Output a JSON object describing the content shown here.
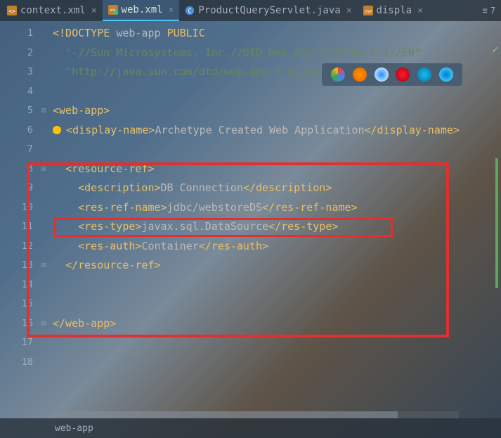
{
  "tabs": [
    {
      "label": "context.xml",
      "icon": "xml",
      "active": false
    },
    {
      "label": "web.xml",
      "icon": "xml-cfg",
      "active": true
    },
    {
      "label": "ProductQueryServlet.java",
      "icon": "java",
      "active": false
    },
    {
      "label": "displa",
      "icon": "jsp",
      "active": false
    }
  ],
  "tab_counter": "7",
  "code_lines": [
    {
      "n": 1,
      "fold": "",
      "tokens": [
        {
          "t": "<!DOCTYPE ",
          "c": "tagname"
        },
        {
          "t": "web-app ",
          "c": "txt"
        },
        {
          "t": "PUBLIC",
          "c": "tagname"
        }
      ]
    },
    {
      "n": 2,
      "fold": "",
      "tokens": [
        {
          "t": "  ",
          "c": ""
        },
        {
          "t": "\"-//Sun Microsystems, Inc.//DTD Web Application 2.3//EN\"",
          "c": "str"
        }
      ]
    },
    {
      "n": 3,
      "fold": "",
      "tokens": [
        {
          "t": "  ",
          "c": ""
        },
        {
          "t": "\"http://java.sun.com/dtd/web-app_2_3.dtd\"",
          "c": "str"
        },
        {
          "t": " >",
          "c": "tagname"
        }
      ]
    },
    {
      "n": 4,
      "fold": "",
      "tokens": []
    },
    {
      "n": 5,
      "fold": "⊟",
      "tokens": [
        {
          "t": "<web-app>",
          "c": "tagname"
        }
      ]
    },
    {
      "n": 6,
      "fold": "",
      "bulb": true,
      "tokens": [
        {
          "t": " ",
          "c": ""
        },
        {
          "t": "<display-name>",
          "c": "tagname"
        },
        {
          "t": "Archetype Created Web Application",
          "c": "txt"
        },
        {
          "t": "</display-name>",
          "c": "tagname"
        }
      ]
    },
    {
      "n": 7,
      "fold": "",
      "tokens": []
    },
    {
      "n": 8,
      "fold": "⊟",
      "tokens": [
        {
          "t": "  ",
          "c": ""
        },
        {
          "t": "<resource-ref>",
          "c": "tagname"
        }
      ]
    },
    {
      "n": 9,
      "fold": "",
      "tokens": [
        {
          "t": "    ",
          "c": ""
        },
        {
          "t": "<description>",
          "c": "tagname"
        },
        {
          "t": "DB Connection",
          "c": "txt"
        },
        {
          "t": "</description>",
          "c": "tagname"
        }
      ]
    },
    {
      "n": 10,
      "fold": "",
      "tokens": [
        {
          "t": "    ",
          "c": ""
        },
        {
          "t": "<res-ref-name>",
          "c": "tagname"
        },
        {
          "t": "jdbc/",
          "c": "txt"
        },
        {
          "t": "webstoreDS",
          "c": "txt",
          "underline": true
        },
        {
          "t": "</res-ref-name>",
          "c": "tagname"
        }
      ]
    },
    {
      "n": 11,
      "fold": "",
      "tokens": [
        {
          "t": "    ",
          "c": ""
        },
        {
          "t": "<res-type>",
          "c": "tagname"
        },
        {
          "t": "javax.sql.DataSource",
          "c": "txt"
        },
        {
          "t": "</res-type>",
          "c": "tagname"
        }
      ]
    },
    {
      "n": 12,
      "fold": "",
      "tokens": [
        {
          "t": "    ",
          "c": ""
        },
        {
          "t": "<res-auth>",
          "c": "tagname"
        },
        {
          "t": "Container",
          "c": "txt"
        },
        {
          "t": "</res-auth>",
          "c": "tagname"
        }
      ]
    },
    {
      "n": 13,
      "fold": "⊟",
      "tokens": [
        {
          "t": "  ",
          "c": ""
        },
        {
          "t": "</resource-ref>",
          "c": "tagname"
        }
      ]
    },
    {
      "n": 14,
      "fold": "",
      "tokens": []
    },
    {
      "n": 15,
      "fold": "",
      "tokens": []
    },
    {
      "n": 16,
      "fold": "⊟",
      "tokens": [
        {
          "t": "</web-app>",
          "c": "tagname"
        }
      ]
    },
    {
      "n": 17,
      "fold": "",
      "tokens": []
    },
    {
      "n": 18,
      "fold": "",
      "tokens": []
    }
  ],
  "browsers": [
    "chrome",
    "firefox",
    "safari",
    "opera",
    "ie",
    "edge"
  ],
  "breadcrumb": "web-app"
}
